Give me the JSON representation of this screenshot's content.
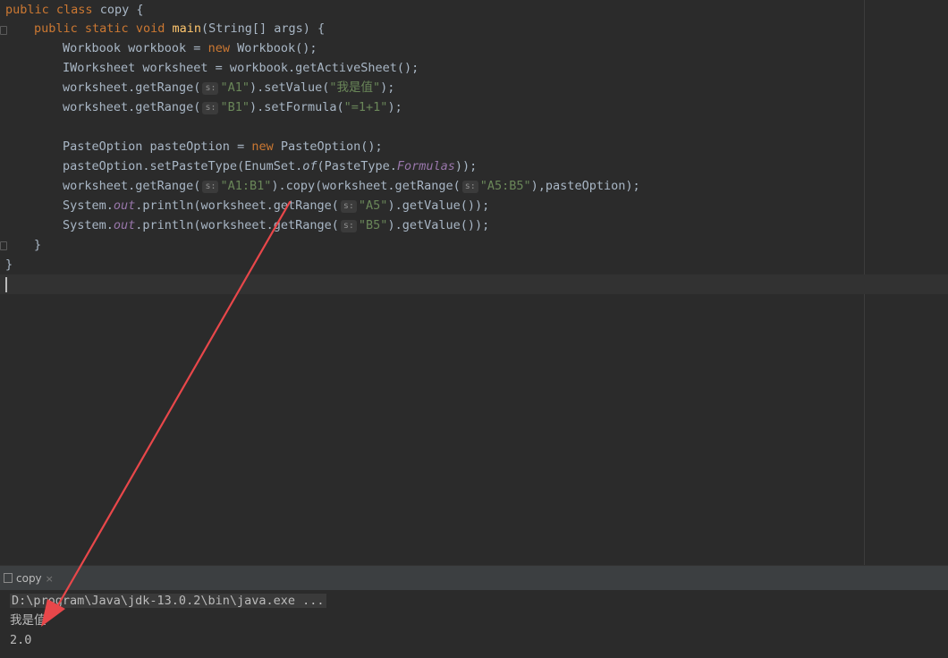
{
  "editor": {
    "lines": {
      "l1": {
        "kw_public": "public",
        "kw_class": "class",
        "name": "copy",
        "brace": " {"
      },
      "l2": {
        "kw_public": "public",
        "kw_static": "static",
        "kw_void": "void",
        "fn": "main",
        "rest": "(String[] args) {"
      },
      "l3": {
        "a": "Workbook workbook = ",
        "kw_new": "new",
        "b": " Workbook();"
      },
      "l4": {
        "a": "IWorksheet worksheet = workbook.getActiveSheet();"
      },
      "l5": {
        "a": "worksheet.getRange(",
        "hint": "s:",
        "str1": "\"A1\"",
        "b": ").setValue(",
        "str2": "\"我是值\"",
        "c": ");"
      },
      "l6": {
        "a": "worksheet.getRange(",
        "hint": "s:",
        "str1": "\"B1\"",
        "b": ").setFormula(",
        "str2": "\"=1+1\"",
        "c": ");"
      },
      "l8": {
        "a": "PasteOption pasteOption = ",
        "kw_new": "new",
        "b": " PasteOption();"
      },
      "l9": {
        "a": "pasteOption.setPasteType(EnumSet.",
        "of": "of",
        "b": "(PasteType.",
        "formulas": "Formulas",
        "c": "));"
      },
      "l10": {
        "a": "worksheet.getRange(",
        "hint1": "s:",
        "str1": "\"A1:B1\"",
        "b": ").copy(worksheet.getRange(",
        "hint2": "s:",
        "str2": "\"A5:B5\"",
        "c": "),pasteOption);"
      },
      "l11": {
        "a": "System.",
        "out": "out",
        "b": ".println(worksheet.getRange(",
        "hint": "s:",
        "str": "\"A5\"",
        "c": ").getValue());"
      },
      "l12": {
        "a": "System.",
        "out": "out",
        "b": ".println(worksheet.getRange(",
        "hint": "s:",
        "str": "\"B5\"",
        "c": ").getValue());"
      },
      "l13": {
        "a": "}"
      },
      "l14": {
        "a": "}"
      }
    }
  },
  "run_panel": {
    "tab_label": "copy",
    "tab_close": "×",
    "console_lines": [
      "D:\\program\\Java\\jdk-13.0.2\\bin\\java.exe ...",
      "我是值",
      "2.0"
    ]
  },
  "annotation": {
    "arrow_color": "#e8474a"
  }
}
